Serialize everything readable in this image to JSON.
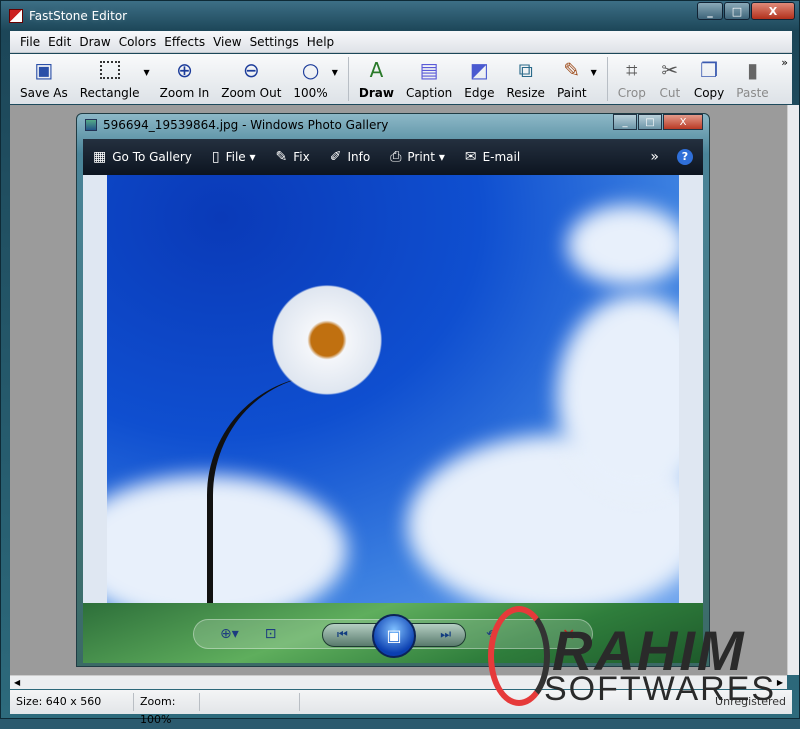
{
  "app": {
    "title": "FastStone Editor"
  },
  "menu": [
    "File",
    "Edit",
    "Draw",
    "Colors",
    "Effects",
    "View",
    "Settings",
    "Help"
  ],
  "toolbar": [
    {
      "label": "Save As",
      "icon": "floppy-icon"
    },
    {
      "label": "Rectangle",
      "icon": "rectangle-select-icon"
    },
    {
      "label": "Zoom In",
      "icon": "zoom-in-icon"
    },
    {
      "label": "Zoom Out",
      "icon": "zoom-out-icon"
    },
    {
      "label": "100%",
      "icon": "zoom-actual-icon"
    },
    {
      "label": "Draw",
      "icon": "draw-icon"
    },
    {
      "label": "Caption",
      "icon": "caption-icon"
    },
    {
      "label": "Edge",
      "icon": "edge-icon"
    },
    {
      "label": "Resize",
      "icon": "resize-icon"
    },
    {
      "label": "Paint",
      "icon": "paint-icon"
    },
    {
      "label": "Crop",
      "icon": "crop-icon"
    },
    {
      "label": "Cut",
      "icon": "scissors-icon"
    },
    {
      "label": "Copy",
      "icon": "copy-icon"
    },
    {
      "label": "Paste",
      "icon": "paste-icon"
    }
  ],
  "gallery": {
    "title": "596694_19539864.jpg - Windows Photo Gallery",
    "toolbar": [
      "Go To Gallery",
      "File",
      "Fix",
      "Info",
      "Print",
      "E-mail"
    ]
  },
  "status": {
    "size": "Size: 640 x 560",
    "zoom": "Zoom: 100%",
    "registration": "Unregistered"
  },
  "watermark": {
    "line1": "RAHIM",
    "line2": "SOFTWARES"
  }
}
